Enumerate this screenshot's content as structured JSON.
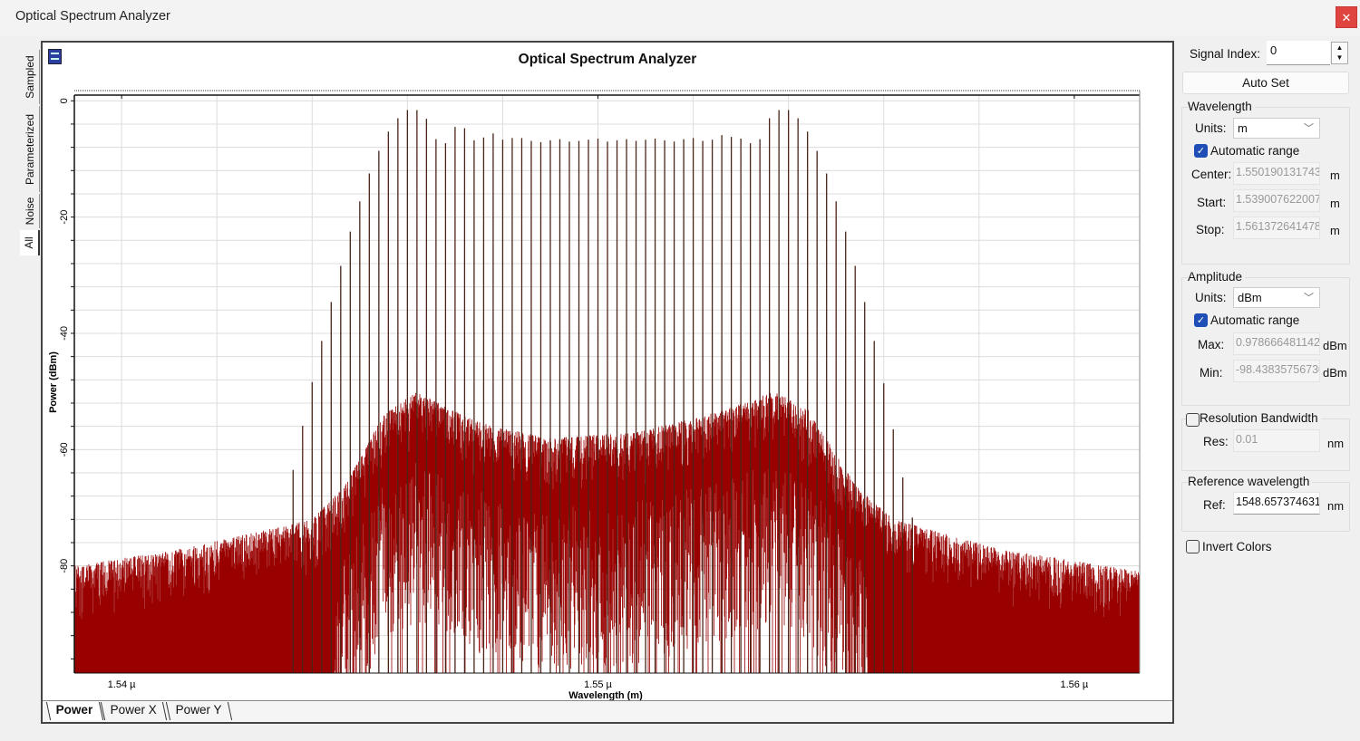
{
  "window": {
    "title": "Optical Spectrum Analyzer",
    "close_icon": "close-icon"
  },
  "side_tabs": [
    "Sampled",
    "Parameterized",
    "Noise",
    "All"
  ],
  "side_tab_active": "All",
  "bottom_tabs": [
    "Power",
    "Power X",
    "Power Y"
  ],
  "bottom_tab_active": "Power",
  "controls": {
    "signal_index_label": "Signal Index:",
    "signal_index": "0",
    "auto_set": "Auto Set",
    "wavelength": {
      "title": "Wavelength",
      "units_label": "Units:",
      "units": "m",
      "auto_range": "Automatic range",
      "auto_checked": true,
      "center_label": "Center:",
      "center": "1.550190131743",
      "start_label": "Start:",
      "start": "1.539007622007",
      "stop_label": "Stop:",
      "stop": "1.561372641478",
      "unit": "m"
    },
    "amplitude": {
      "title": "Amplitude",
      "units_label": "Units:",
      "units": "dBm",
      "auto_range": "Automatic range",
      "auto_checked": true,
      "max_label": "Max:",
      "max": "0.978666481142",
      "min_label": "Min:",
      "min": "-98.43835756730",
      "unit": "dBm"
    },
    "resolution": {
      "title": "Resolution Bandwidth",
      "checked": false,
      "res_label": "Res:",
      "res": "0.01",
      "unit": "nm"
    },
    "reference": {
      "title": "Reference wavelength",
      "ref_label": "Ref:",
      "ref": "1548.657374631",
      "unit": "nm"
    },
    "invert_colors": {
      "label": "Invert Colors",
      "checked": false
    }
  },
  "chart_data": {
    "type": "line",
    "title": "Optical Spectrum Analyzer",
    "xlabel": "Wavelength (m)",
    "ylabel": "Power (dBm)",
    "xlim_um": [
      1.539007622007,
      1.561372641478
    ],
    "ylim": [
      -98.4383575673,
      0.978666481142
    ],
    "x_ticks": [
      {
        "value": 1.54,
        "label": "1.54 µ"
      },
      {
        "value": 1.55,
        "label": "1.55 µ"
      },
      {
        "value": 1.56,
        "label": "1.56 µ"
      }
    ],
    "y_ticks": [
      {
        "value": 0,
        "label": "0"
      },
      {
        "value": -20,
        "label": "-20"
      },
      {
        "value": -40,
        "label": "-40"
      },
      {
        "value": -60,
        "label": "-60"
      },
      {
        "value": -80,
        "label": "-80"
      }
    ],
    "grid": true,
    "colors": {
      "noise": "#990000",
      "peaks": "#4a2418",
      "grid": "#dcdcdc"
    },
    "peak_start_um": 1.5436,
    "peak_spacing_um": 0.0002,
    "peak_dbm": [
      -63.5,
      -55.9,
      -48.4,
      -41.3,
      -34.6,
      -28.4,
      -22.5,
      -17.3,
      -12.5,
      -8.6,
      -5.3,
      -3.0,
      -1.6,
      -1.6,
      -3.1,
      -6.6,
      -7.3,
      -4.5,
      -4.7,
      -6.8,
      -6.3,
      -5.6,
      -6.7,
      -6.4,
      -6.4,
      -6.9,
      -7.1,
      -6.8,
      -6.6,
      -7.0,
      -6.9,
      -6.7,
      -6.5,
      -7.0,
      -6.8,
      -6.6,
      -6.9,
      -6.7,
      -6.5,
      -6.8,
      -7.0,
      -6.6,
      -6.4,
      -6.9,
      -6.7,
      -5.9,
      -6.2,
      -6.5,
      -7.3,
      -6.6,
      -3.0,
      -1.6,
      -1.6,
      -3.0,
      -5.3,
      -8.6,
      -12.5,
      -17.3,
      -22.5,
      -28.4,
      -34.6,
      -41.3,
      -48.6,
      -56.5,
      -64.8,
      -71.7
    ],
    "noise_envelope": [
      [
        1.53901,
        -80
      ],
      [
        1.5413,
        -77
      ],
      [
        1.544,
        -72
      ],
      [
        1.5447,
        -66
      ],
      [
        1.5455,
        -54
      ],
      [
        1.5462,
        -50
      ],
      [
        1.5474,
        -55
      ],
      [
        1.5489,
        -58
      ],
      [
        1.5508,
        -57
      ],
      [
        1.5523,
        -54
      ],
      [
        1.5537,
        -50
      ],
      [
        1.5544,
        -53
      ],
      [
        1.5554,
        -66
      ],
      [
        1.5562,
        -72
      ],
      [
        1.5584,
        -77
      ],
      [
        1.5614,
        -81
      ]
    ]
  }
}
